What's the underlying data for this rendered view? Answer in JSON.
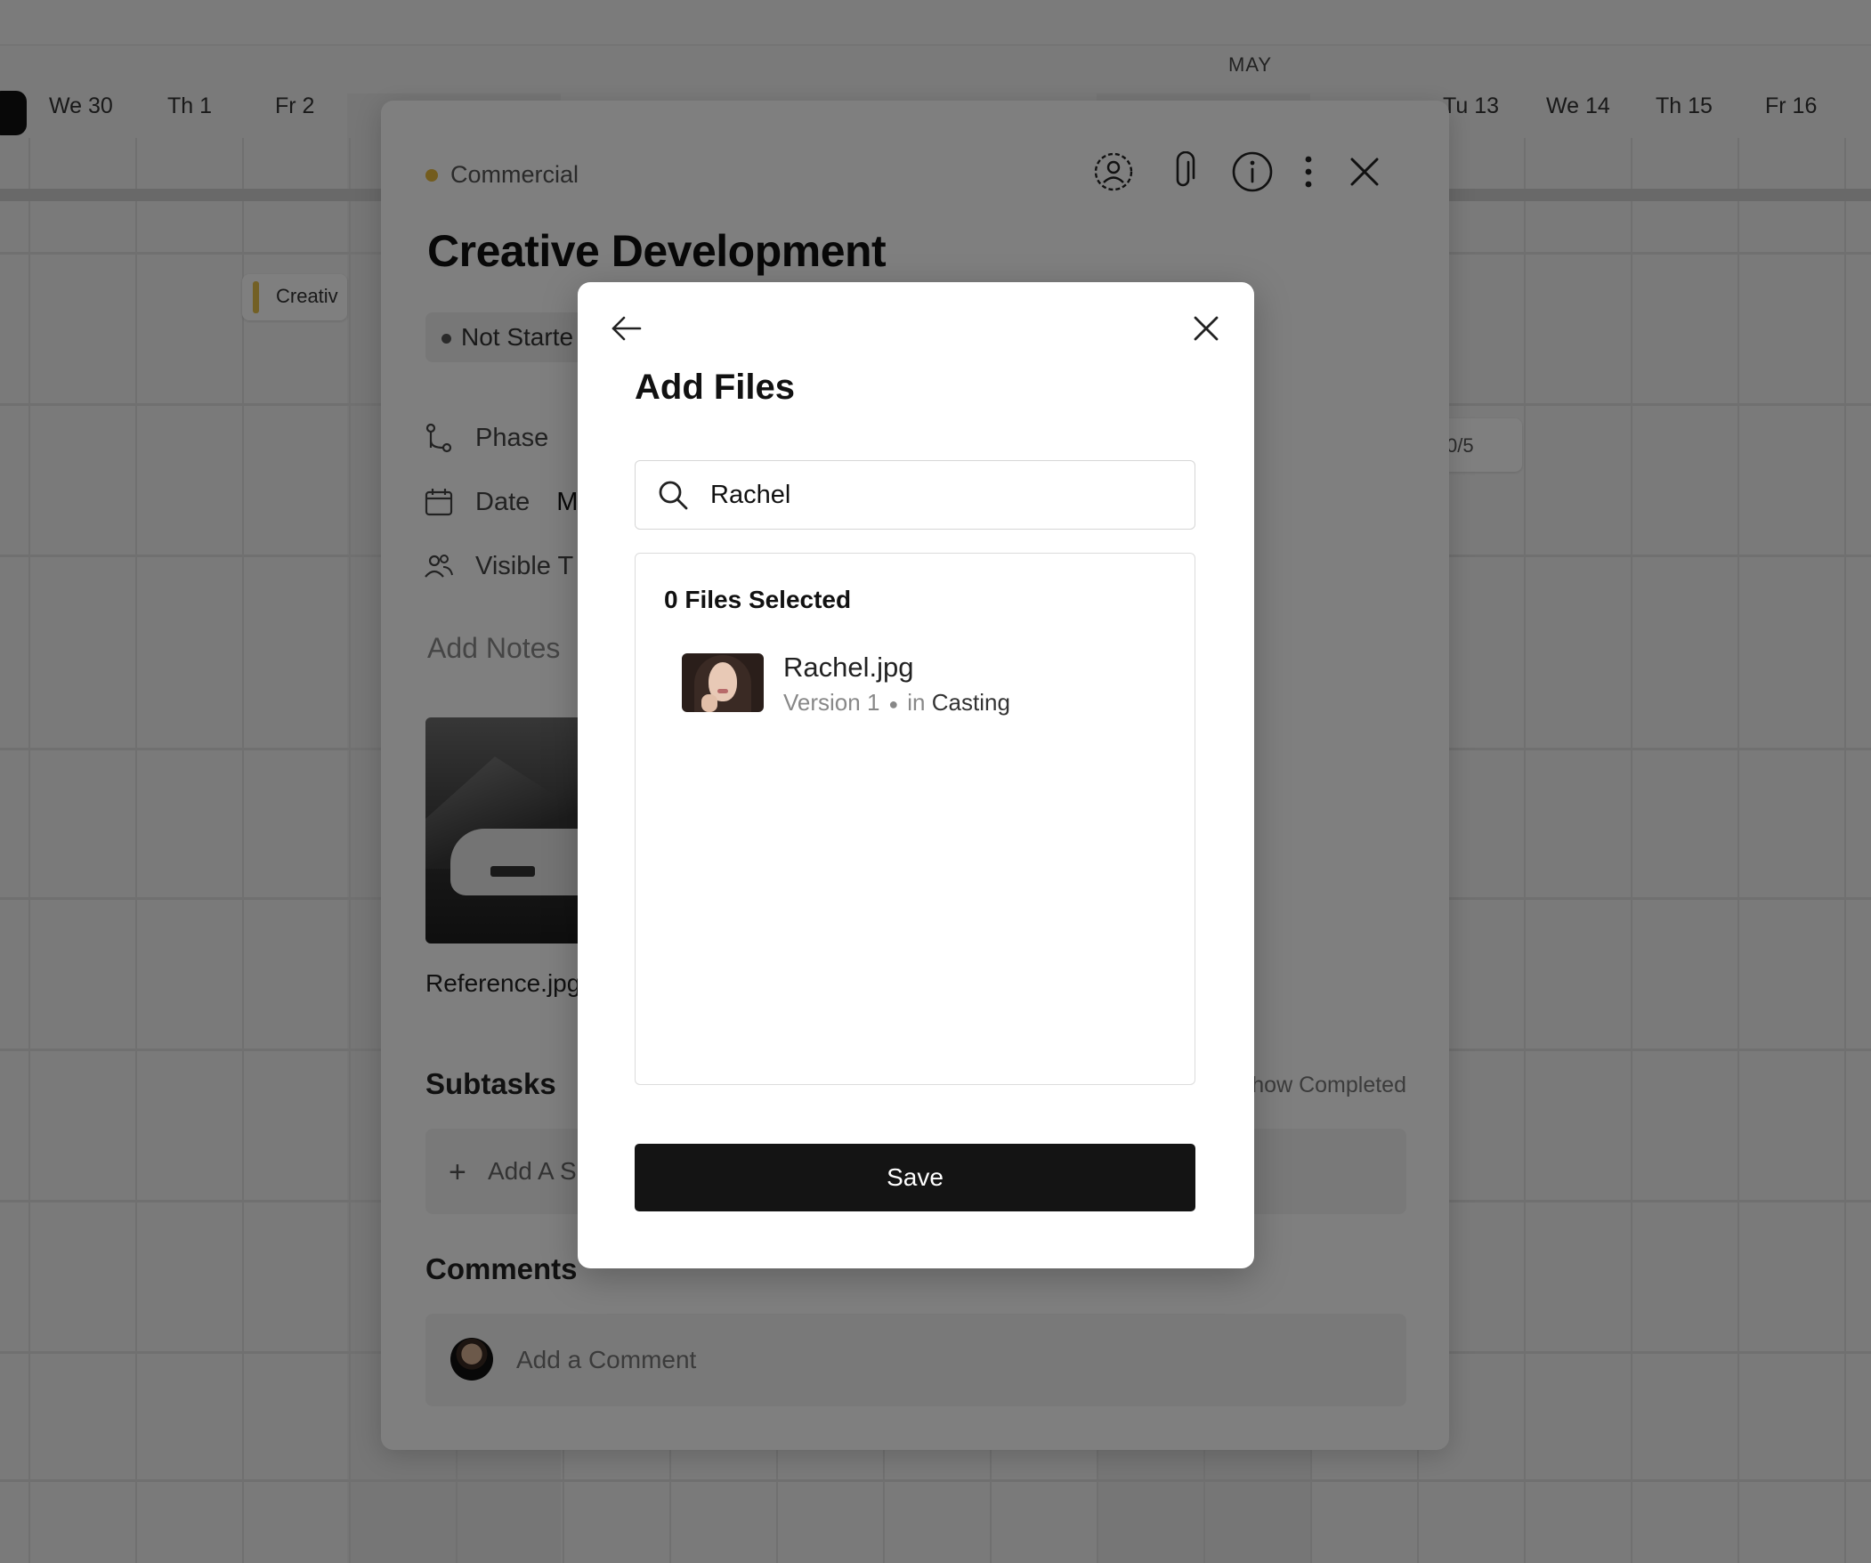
{
  "calendar": {
    "month": "MAY",
    "days": [
      "We 30",
      "Th 1",
      "Fr 2",
      "Tu 13",
      "We 14",
      "Th 15",
      "Fr 16"
    ],
    "event_label": "Creativ",
    "chip_label": "0/5"
  },
  "task": {
    "category": "Commercial",
    "title": "Creative Development",
    "status": "Not Starte",
    "fields": {
      "phase_label": "Phase",
      "date_label": "Date",
      "date_value": "M",
      "visible_label": "Visible T"
    },
    "notes_placeholder": "Add Notes",
    "attachment_name": "Reference.jpg",
    "subtasks_heading": "Subtasks",
    "show_completed": "how Completed",
    "add_subtask": "Add A S",
    "comments_heading": "Comments",
    "comment_placeholder": "Add a Comment"
  },
  "modal": {
    "title": "Add Files",
    "search_value": "Rachel",
    "selected_count": "0 Files Selected",
    "files": [
      {
        "name": "Rachel.jpg",
        "version": "Version 1",
        "in_label": "in",
        "location": "Casting"
      }
    ],
    "save_label": "Save"
  },
  "colors": {
    "category_dot": "#e6b93d",
    "save_button": "#141414",
    "overlay": "rgba(0,0,0,0.5)"
  }
}
